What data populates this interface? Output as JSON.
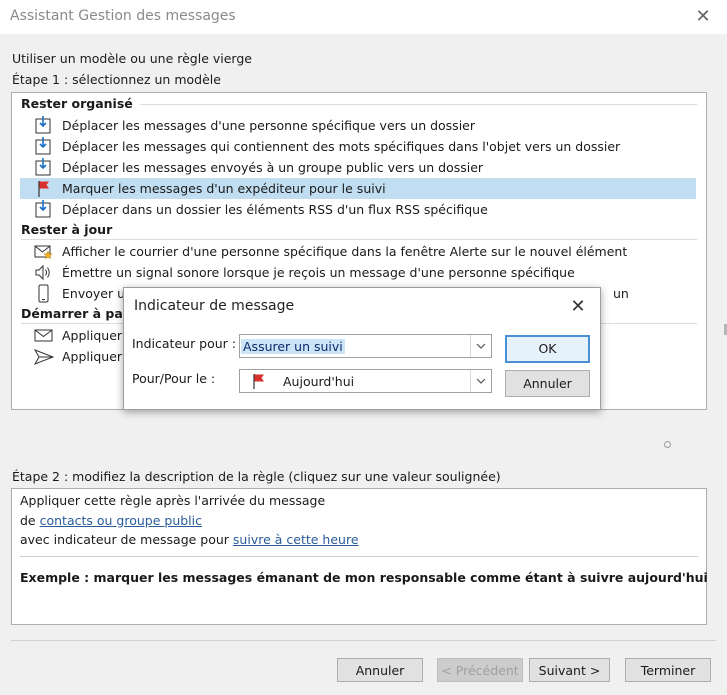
{
  "window": {
    "title": "Assistant Gestion des messages"
  },
  "header": {
    "subtitle": "Utiliser un modèle ou une règle vierge",
    "step1": "Étape 1 : sélectionnez un modèle"
  },
  "templates": {
    "groups": [
      {
        "title": "Rester organisé",
        "items": [
          {
            "label": "Déplacer les messages d'une personne spécifique vers un dossier",
            "icon": "move-to-folder-icon"
          },
          {
            "label": "Déplacer les messages qui contiennent des mots spécifiques dans l'objet vers un dossier",
            "icon": "move-to-folder-icon"
          },
          {
            "label": "Déplacer les messages envoyés à un groupe public vers un dossier",
            "icon": "move-to-folder-icon"
          },
          {
            "label": "Marquer les messages d'un expéditeur pour le suivi",
            "icon": "red-flag-icon",
            "selected": true
          },
          {
            "label": "Déplacer dans un dossier les éléments RSS d'un flux RSS spécifique",
            "icon": "move-to-folder-icon"
          }
        ]
      },
      {
        "title": "Rester à jour",
        "items": [
          {
            "label": "Afficher le courrier d'une personne spécifique dans la fenêtre Alerte sur le nouvel élément",
            "icon": "envelope-star-icon"
          },
          {
            "label": "Émettre un signal sonore lorsque je reçois un message d'une personne spécifique",
            "icon": "speaker-icon"
          },
          {
            "label": "Envoyer un",
            "label_tail": "un",
            "icon": "mobile-phone-icon"
          }
        ]
      },
      {
        "title": "Démarrer à parti",
        "items": [
          {
            "label": "Appliquer",
            "icon": "envelope-icon"
          },
          {
            "label": "Appliquer",
            "icon": "send-icon"
          }
        ]
      }
    ]
  },
  "step2": {
    "label": "Étape 2 : modifiez la description de la règle (cliquez sur une valeur soulignée)",
    "line1": "Appliquer cette règle après l'arrivée du message",
    "line2_prefix": "de ",
    "line2_link": "contacts ou groupe public",
    "line3_prefix": "avec indicateur de message pour ",
    "line3_link": "suivre à cette heure",
    "example": "Exemple : marquer les messages émanant de mon responsable comme étant à suivre aujourd'hui"
  },
  "buttons": {
    "cancel": "Annuler",
    "previous": "< Précédent",
    "next": "Suivant >",
    "finish": "Terminer"
  },
  "dialog": {
    "title": "Indicateur de message",
    "flag_for_label": "Indicateur pour :",
    "flag_for_value": "Assurer un suivi",
    "due_label": "Pour/Pour le :",
    "due_value": "Aujourd'hui",
    "ok": "OK",
    "cancel": "Annuler"
  },
  "colors": {
    "selection": "#c1ddf1",
    "link": "#2a5c9a",
    "flag": "#d9302c",
    "default_button_border": "#4a8fd6"
  }
}
